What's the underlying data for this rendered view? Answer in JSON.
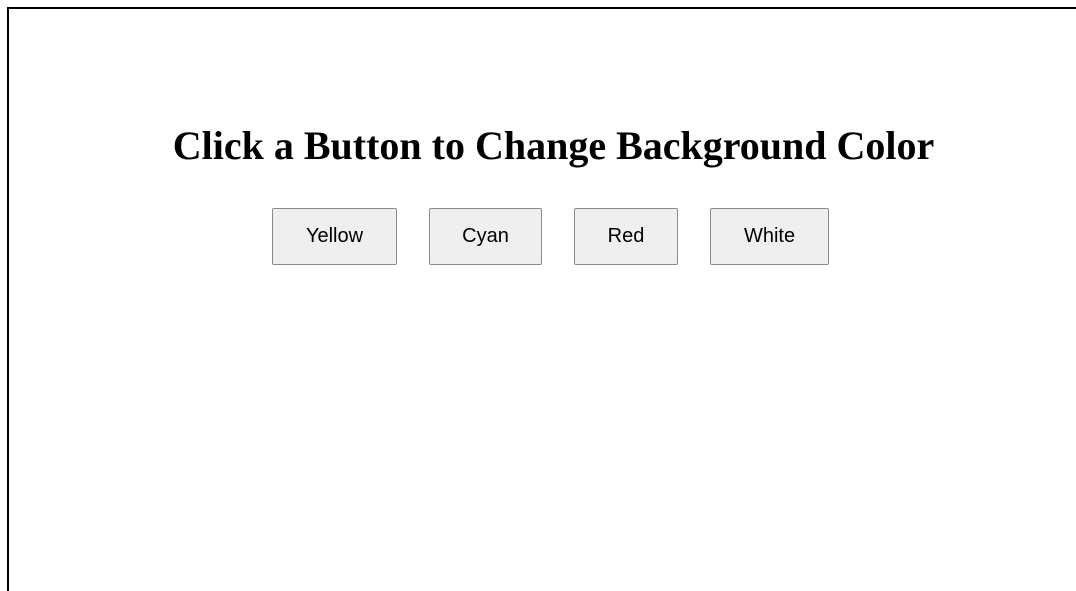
{
  "page": {
    "title": "Click a Button to Change Background Color"
  },
  "buttons": [
    {
      "label": "Yellow",
      "color": "#ffff00"
    },
    {
      "label": "Cyan",
      "color": "#00ffff"
    },
    {
      "label": "Red",
      "color": "#ff0000"
    },
    {
      "label": "White",
      "color": "#ffffff"
    }
  ],
  "colors": {
    "background": "#ffffff",
    "button_face": "#efefef",
    "button_border": "#8a8a8a",
    "frame_border": "#000000"
  }
}
